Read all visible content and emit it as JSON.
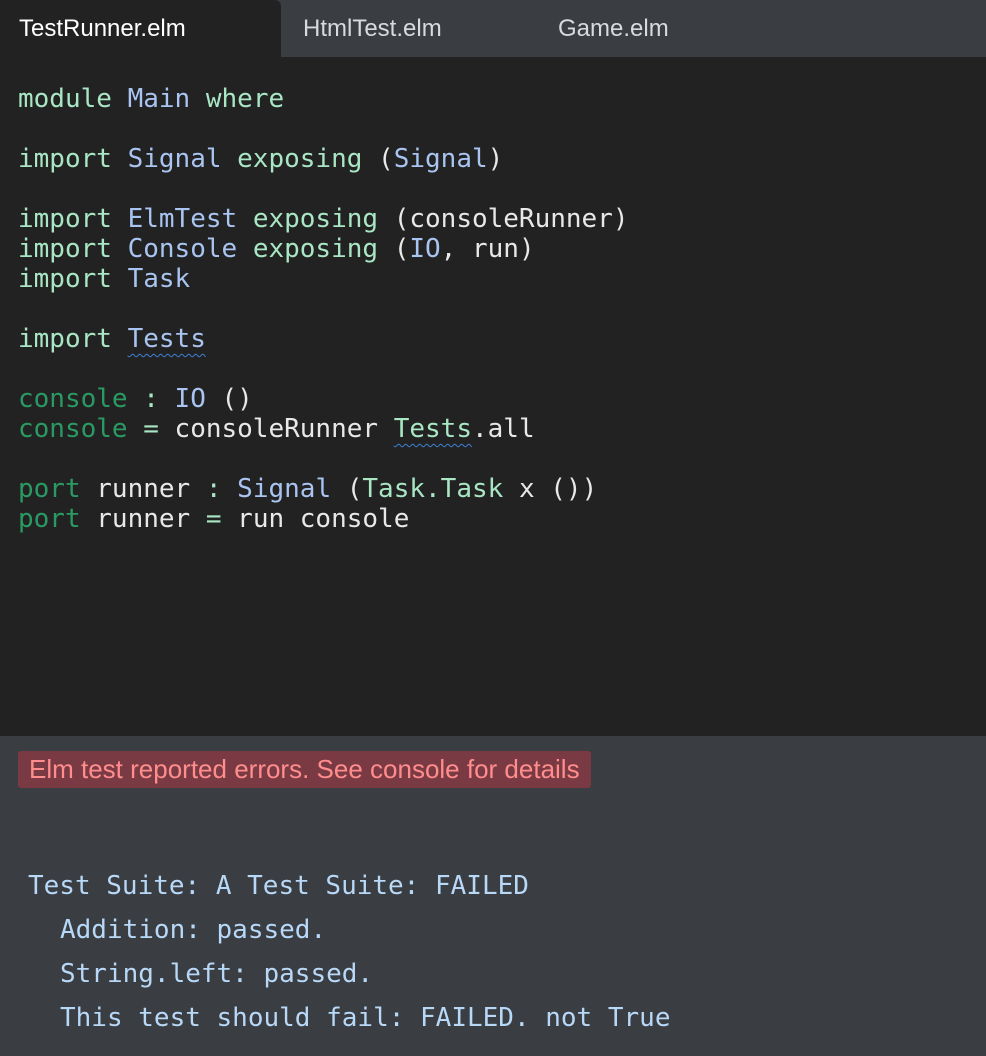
{
  "tabs": [
    {
      "label": "TestRunner.elm",
      "active": true
    },
    {
      "label": "HtmlTest.elm",
      "active": false
    },
    {
      "label": "Game.elm",
      "active": false
    }
  ],
  "code": {
    "l1": {
      "a": "module",
      "b": " ",
      "c": "Main",
      "d": " ",
      "e": "where"
    },
    "l3": {
      "a": "import",
      "b": " ",
      "c": "Signal",
      "d": " ",
      "e": "exposing",
      "f": " (",
      "g": "Signal",
      "h": ")"
    },
    "l5": {
      "a": "import",
      "b": " ",
      "c": "ElmTest",
      "d": " ",
      "e": "exposing",
      "f": " (consoleRunner)"
    },
    "l6": {
      "a": "import",
      "b": " ",
      "c": "Console",
      "d": " ",
      "e": "exposing",
      "f": " (",
      "g": "IO",
      "h": ", run)"
    },
    "l7": {
      "a": "import",
      "b": " ",
      "c": "Task"
    },
    "l9": {
      "a": "import",
      "b": " ",
      "c": "Tests"
    },
    "l11": {
      "a": "console",
      "b": " ",
      "c": ":",
      "d": " ",
      "e": "IO",
      "f": " ()"
    },
    "l12": {
      "a": "console",
      "b": " ",
      "c": "=",
      "d": " consoleRunner ",
      "e": "Tests",
      "f": ".all"
    },
    "l14": {
      "a": "port",
      "b": " runner ",
      "c": ":",
      "d": " ",
      "e": "Signal",
      "f": " (",
      "g": "Task.Task",
      "h": " x ())"
    },
    "l15": {
      "a": "port",
      "b": " runner ",
      "c": "=",
      "d": " run console"
    }
  },
  "error_banner": "Elm test reported errors. See console for details",
  "output": [
    "Test Suite: A Test Suite: FAILED",
    "Addition: passed.",
    "String.left: passed.",
    "This test should fail: FAILED. not True"
  ],
  "colors": {
    "keyword": "#a8e6c4",
    "type": "#a9c4f0",
    "function": "#2a9a63",
    "error_bg": "#7a3a43",
    "error_text": "#ff8d8d"
  }
}
